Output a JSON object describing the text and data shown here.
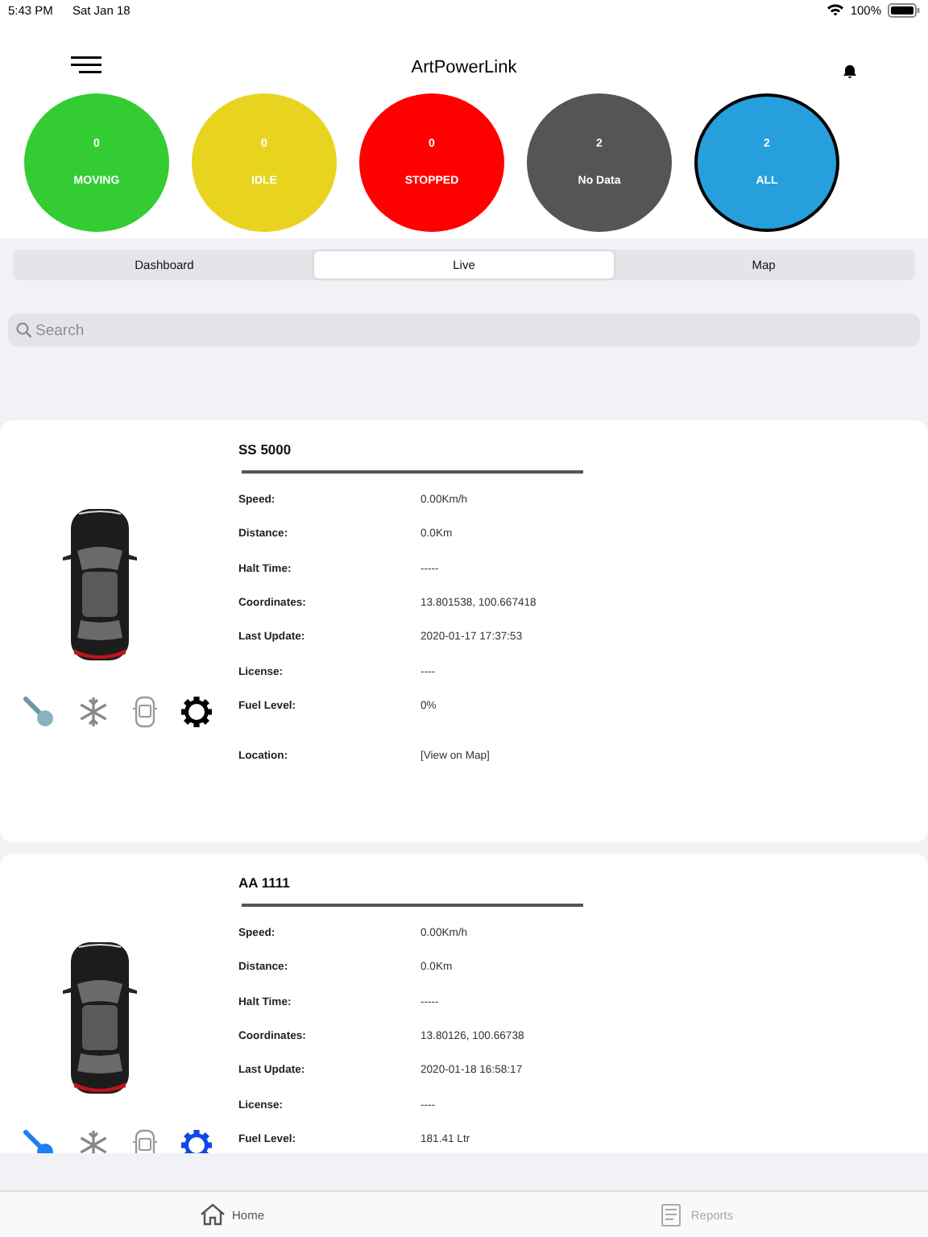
{
  "status_bar": {
    "time": "5:43 PM",
    "date": "Sat Jan 18",
    "battery": "100%"
  },
  "header": {
    "title": "ArtPowerLink"
  },
  "summary": [
    {
      "count": "0",
      "label": "MOVING",
      "color": "#33cc33",
      "selected": false
    },
    {
      "count": "0",
      "label": "IDLE",
      "color": "#e8d41f",
      "selected": false
    },
    {
      "count": "0",
      "label": "STOPPED",
      "color": "#ff0000",
      "selected": false
    },
    {
      "count": "2",
      "label": "No Data",
      "color": "#555555",
      "selected": false
    },
    {
      "count": "2",
      "label": "ALL",
      "color": "#279fdc",
      "selected": true
    }
  ],
  "segments": [
    {
      "label": "Dashboard",
      "selected": false
    },
    {
      "label": "Live",
      "selected": true
    },
    {
      "label": "Map",
      "selected": false
    }
  ],
  "search": {
    "placeholder": "Search"
  },
  "vehicles": [
    {
      "name": "SS 5000",
      "fields": [
        {
          "label": "Speed:",
          "value": "0.00Km/h"
        },
        {
          "label": "Distance:",
          "value": "0.0Km"
        },
        {
          "label": "Halt Time:",
          "value": "-----"
        },
        {
          "label": "Coordinates:",
          "value": "13.801538, 100.667418"
        },
        {
          "label": "Last Update:",
          "value": "2020-01-17 17:37:53"
        },
        {
          "label": "License:",
          "value": "----"
        },
        {
          "label": "Fuel Level:",
          "value": "0%"
        }
      ],
      "indicators": [
        {
          "kind": "key",
          "on": false
        },
        {
          "kind": "snowflake",
          "on": false
        },
        {
          "kind": "car",
          "on": false
        },
        {
          "kind": "gear",
          "on": false
        }
      ],
      "location": {
        "label": "Location:",
        "link": "[View on Map]"
      }
    },
    {
      "name": "AA 1111",
      "fields": [
        {
          "label": "Speed:",
          "value": "0.00Km/h"
        },
        {
          "label": "Distance:",
          "value": "0.0Km"
        },
        {
          "label": "Halt Time:",
          "value": "-----"
        },
        {
          "label": "Coordinates:",
          "value": "13.80126, 100.66738"
        },
        {
          "label": "Last Update:",
          "value": "2020-01-18 16:58:17"
        },
        {
          "label": "License:",
          "value": "----"
        },
        {
          "label": "Fuel Level:",
          "value": "181.41 Ltr"
        }
      ],
      "indicators": [
        {
          "kind": "key",
          "on": true
        },
        {
          "kind": "snowflake",
          "on": false
        },
        {
          "kind": "car",
          "on": false
        },
        {
          "kind": "gear",
          "on": true
        }
      ]
    }
  ],
  "tab_bar": [
    {
      "label": "Home",
      "kind": "home",
      "selected": true
    },
    {
      "label": "Reports",
      "kind": "reports",
      "selected": false
    }
  ]
}
